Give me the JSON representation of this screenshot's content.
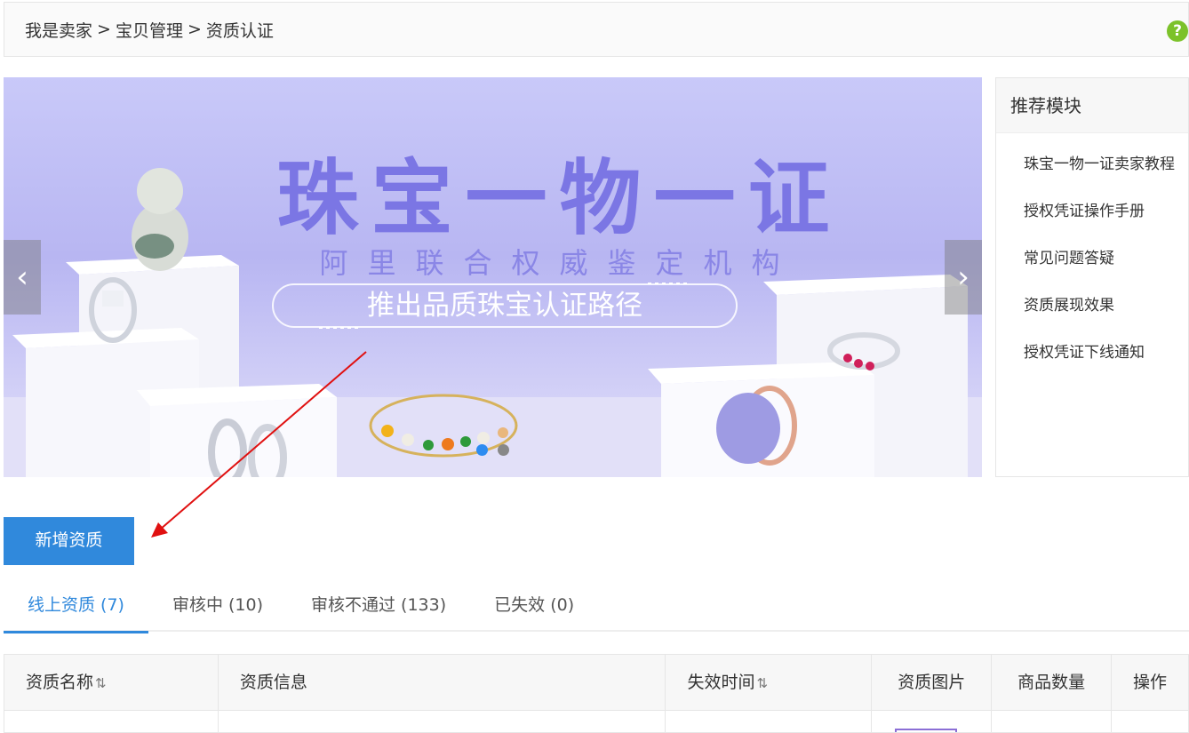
{
  "breadcrumb": {
    "items": [
      "我是卖家",
      "宝贝管理",
      "资质认证"
    ],
    "separator": ">"
  },
  "help": {
    "symbol": "?"
  },
  "banner": {
    "title": "珠宝一物一证",
    "subtitle": "阿里联合权威鉴定机构",
    "tagline": "推出品质珠宝认证路径",
    "prev_symbol": "‹",
    "next_symbol": "›",
    "slide_count": 2,
    "active_slide": 1
  },
  "side_panel": {
    "title": "推荐模块",
    "links": [
      "珠宝一物一证卖家教程",
      "授权凭证操作手册",
      "常见问题答疑",
      "资质展现效果",
      "授权凭证下线通知"
    ]
  },
  "add_button": {
    "label": "新增资质"
  },
  "tabs": [
    {
      "label": "线上资质 (7)",
      "active": true
    },
    {
      "label": "审核中 (10)",
      "active": false
    },
    {
      "label": "审核不通过 (133)",
      "active": false
    },
    {
      "label": "已失效 (0)",
      "active": false
    }
  ],
  "table": {
    "columns": [
      "资质名称",
      "资质信息",
      "失效时间",
      "资质图片",
      "商品数量",
      "操作"
    ],
    "sort_symbol": "⇅"
  },
  "colors": {
    "primary": "#3089dc",
    "annotation_arrow": "#e01010",
    "banner_title": "#7b76e4"
  }
}
